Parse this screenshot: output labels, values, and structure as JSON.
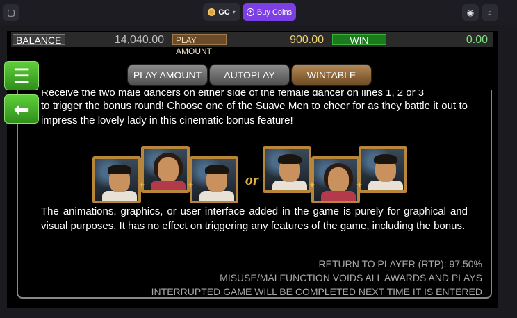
{
  "topbar": {
    "currency": "GC",
    "buy_coins": "Buy Coins",
    "icons": [
      "sidebar-toggle-icon",
      "user-icon",
      "search-icon"
    ]
  },
  "status": {
    "balance_label": "BALANCE",
    "balance_value": "14,040.00",
    "play_amount_label": "PLAY AMOUNT",
    "play_amount_value": "900.00",
    "win_label": "WIN",
    "win_value": "0.00"
  },
  "tabs": {
    "play_amount": "PLAY AMOUNT",
    "autoplay": "AUTOPLAY",
    "wintable": "WINTABLE"
  },
  "content": {
    "para1_cut": "Receive the two male dancers on either side of the female dancer on lines 1, 2 or 3",
    "para1": "to trigger the bonus round! Choose one of the Suave Men to cheer for as they battle it out to impress the lovely lady in this cinematic bonus feature!",
    "or_label": "or",
    "para2": "The animations, graphics, or user interface added in the game is purely for graphical and visual purposes. It has no effect on triggering any features of the game, including the bonus.",
    "rtp": "RETURN TO PLAYER (RTP): 97.50%",
    "misuse": "MISUSE/MALFUNCTION VOIDS ALL AWARDS AND PLAYS",
    "interrupted": "INTERRUPTED GAME WILL BE COMPLETED NEXT TIME IT IS ENTERED"
  }
}
